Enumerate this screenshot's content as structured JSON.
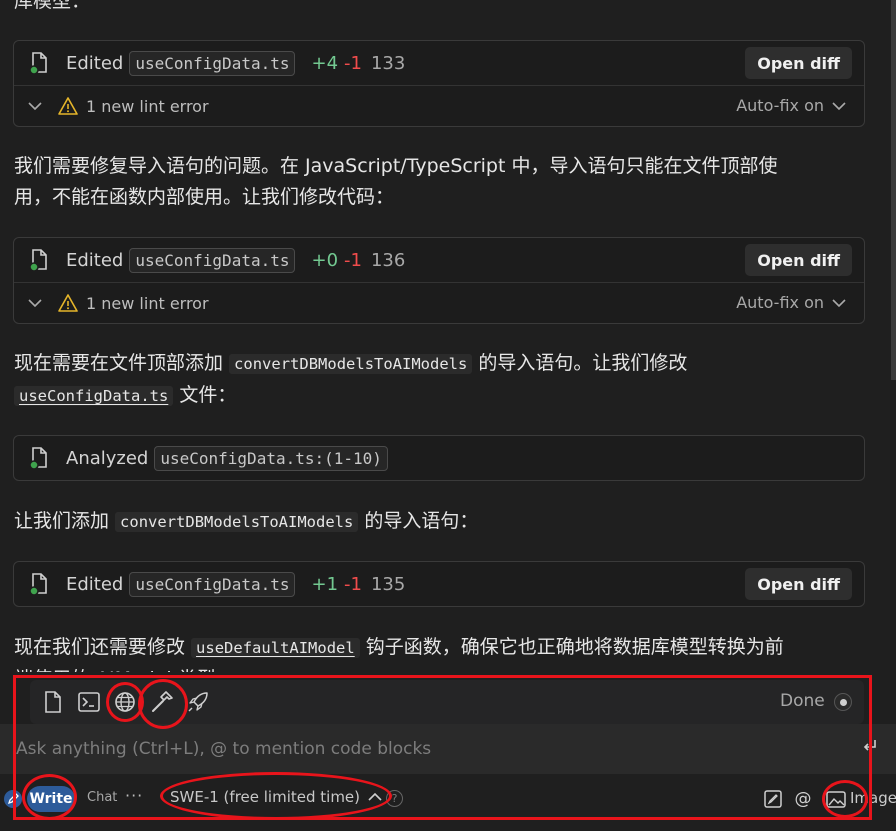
{
  "cut_top_text": "库模型：",
  "cards": [
    {
      "action": "Edited",
      "file": "useConfigData.ts",
      "added": "+4",
      "removed": "-1",
      "total": "133",
      "open_diff": "Open diff",
      "lint": "1 new lint error",
      "autofix": "Auto-fix on"
    },
    {
      "action": "Edited",
      "file": "useConfigData.ts",
      "added": "+0",
      "removed": "-1",
      "total": "136",
      "open_diff": "Open diff",
      "lint": "1 new lint error",
      "autofix": "Auto-fix on"
    },
    {
      "action": "Analyzed",
      "file": "useConfigData.ts:(1-10)"
    },
    {
      "action": "Edited",
      "file": "useConfigData.ts",
      "added": "+1",
      "removed": "-1",
      "total": "135",
      "open_diff": "Open diff"
    }
  ],
  "paragraphs": {
    "p1_line1": "我们需要修复导入语句的问题。在 JavaScript/TypeScript 中，导入语句只能在文件顶部使",
    "p1_line2": "用，不能在函数内部使用。让我们修改代码：",
    "p2_a": "现在需要在文件顶部添加 ",
    "p2_code1": "convertDBModelsToAIModels",
    "p2_b": " 的导入语句。让我们修改",
    "p2_code2": "useConfigData.ts",
    "p2_c": " 文件：",
    "p3_a": "让我们添加 ",
    "p3_code": "convertDBModelsToAIModels",
    "p3_b": " 的导入语句：",
    "p4_a": "现在我们还需要修改 ",
    "p4_code": "useDefaultAIModel",
    "p4_b": " 钩子函数，确保它也正确地将数据库模型转换为前",
    "p4_line2": "端使用的 AIModel 类型："
  },
  "toolbar": {
    "icons": [
      "file-icon",
      "terminal-icon",
      "globe-icon",
      "hammer-icon",
      "rocket-icon"
    ],
    "done_label": "Done"
  },
  "input": {
    "placeholder": "Ask anything (Ctrl+L), @ to mention code blocks"
  },
  "bottom": {
    "write_label": "Write",
    "chat_label": "Chat",
    "more_label": "···",
    "model_label": "SWE-1 (free limited time)",
    "help_label": "?",
    "image_label": "Image"
  },
  "colors": {
    "added": "#73c991",
    "removed": "#f14c4c",
    "write_button": "#2d5b9a",
    "annotation_red": "#e8141b"
  }
}
